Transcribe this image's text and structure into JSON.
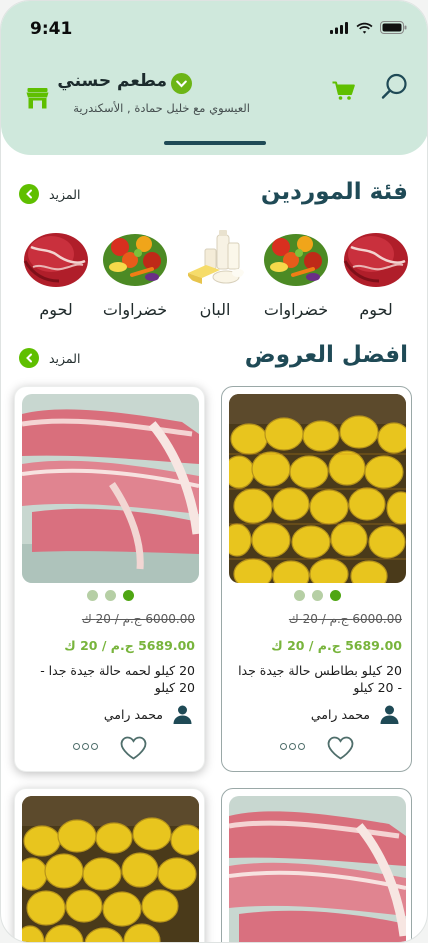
{
  "status": {
    "time": "9:41"
  },
  "store": {
    "name": "مطعم حسني",
    "address": "العيسوي مع خليل حمادة , الأسكندرية"
  },
  "suppliers": {
    "title": "فئة الموردين",
    "more_label": "المزيد",
    "categories": [
      {
        "label": "لحوم",
        "icon": "meat-image"
      },
      {
        "label": "خضراوات",
        "icon": "vegetables-image"
      },
      {
        "label": "البان",
        "icon": "dairy-image"
      },
      {
        "label": "خضراوات",
        "icon": "vegetables-image"
      },
      {
        "label": "لحوم",
        "icon": "meat-image"
      }
    ]
  },
  "offers": {
    "title": "افضل العروض",
    "more_label": "المزيد",
    "products": [
      {
        "old_price": "6000.00 ج.م / 20 ك",
        "new_price": "5689.00 ج.م / 20 ك",
        "title": "20 كيلو بطاطس حالة جيدة جدا - 20 كيلو",
        "seller": "محمد رامي",
        "image": "potatoes-image"
      },
      {
        "old_price": "6000.00 ج.م / 20 ك",
        "new_price": "5689.00 ج.م / 20 ك",
        "title": "20 كيلو لحمه حالة جيدة جدا - 20 كيلو",
        "seller": "محمد رامي",
        "image": "meat-image"
      }
    ]
  },
  "colors": {
    "header_bg": "#cfe8dc",
    "brand_dark": "#1f4a56",
    "accent_green": "#5fbf00",
    "price_green": "#78b43c"
  }
}
